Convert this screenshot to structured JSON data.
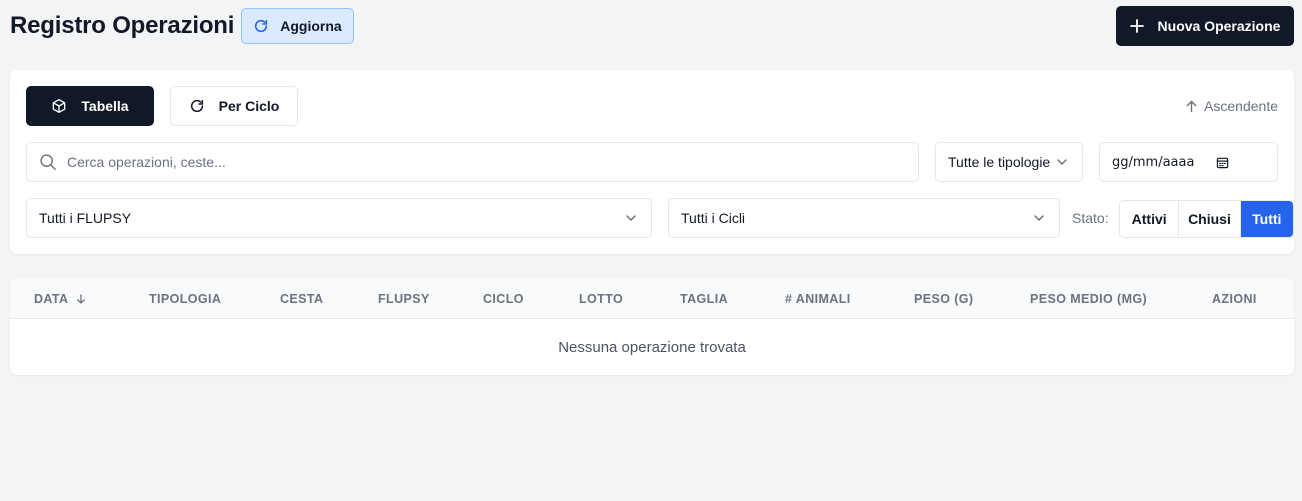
{
  "header": {
    "title": "Registro Operazioni",
    "refresh_label": "Aggiorna",
    "new_operation_label": "Nuova Operazione"
  },
  "filters": {
    "view_table_label": "Tabella",
    "view_cycle_label": "Per Ciclo",
    "sort_label": "Ascendente",
    "search_placeholder": "Cerca operazioni, ceste...",
    "type_select_value": "Tutte le tipologie",
    "date_placeholder": "gg/mm/aaaa",
    "flupsy_select_value": "Tutti i FLUPSY",
    "cycle_select_value": "Tutti i Cicli",
    "state_label": "Stato:",
    "state_options": [
      "Attivi",
      "Chiusi",
      "Tutti"
    ],
    "state_selected": "Tutti"
  },
  "table": {
    "columns": [
      "DATA",
      "TIPOLOGIA",
      "CESTA",
      "FLUPSY",
      "CICLO",
      "LOTTO",
      "TAGLIA",
      "# ANIMALI",
      "PESO (G)",
      "PESO MEDIO (MG)",
      "AZIONI"
    ],
    "sorted_column": "DATA",
    "empty_message": "Nessuna operazione trovata"
  },
  "icons": {
    "refresh": "refresh-icon",
    "plus": "plus-icon",
    "table_view": "cube-icon",
    "cycle_view": "cycle-icon",
    "sort": "arrow-up-icon",
    "search": "search-icon",
    "chevron": "chevron-down-icon",
    "calendar": "calendar-icon",
    "sort_column": "arrow-down-icon"
  },
  "colors": {
    "primary_dark": "#111827",
    "accent_blue": "#2563eb",
    "refresh_bg": "#dbeafe",
    "page_bg": "#f3f4f6"
  }
}
